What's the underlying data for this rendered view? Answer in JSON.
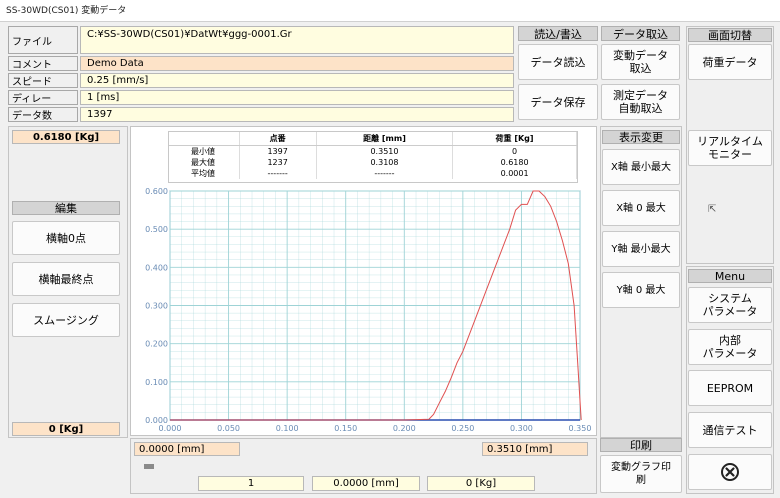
{
  "window": {
    "title": "SS-30WD(CS01) 変動データ"
  },
  "info": {
    "file_label": "ファイル",
    "file_value": "C:¥SS-30WD(CS01)¥DatWt¥ggg-0001.Gr",
    "comment_label": "コメント",
    "comment_value": "Demo Data",
    "speed_label": "スピード",
    "speed_value": "0.25 [mm/s]",
    "delay_label": "ディレー",
    "delay_value": "1 [ms]",
    "count_label": "データ数",
    "count_value": "1397"
  },
  "io": {
    "readwrite_header": "読込/書込",
    "load_button": "データ読込",
    "save_button": "データ保存",
    "fetch_header": "データ取込",
    "fetch_var_button": "変動データ\n取込",
    "fetch_auto_button": "測定データ\n自動取込"
  },
  "left": {
    "max_load": "0.6180 [Kg]",
    "edit_header": "編集",
    "zero_button": "横軸0点",
    "end_button": "横軸最終点",
    "smoothing_button": "スムージング",
    "min_load": "0 [Kg]"
  },
  "stats": {
    "headers": [
      "",
      "点番",
      "距離 [mm]",
      "荷重 [Kg]"
    ],
    "rows": [
      [
        "最小値",
        "1397",
        "0.3510",
        "0"
      ],
      [
        "最大値",
        "1237",
        "0.3108",
        "0.6180"
      ],
      [
        "平均値",
        "-------",
        "-------",
        "0.0001"
      ]
    ]
  },
  "xrange": {
    "min": "0.0000 [mm]",
    "max": "0.3510 [mm]"
  },
  "cursor": {
    "index": "1",
    "distance": "0.0000 [mm]",
    "load": "0 [Kg]"
  },
  "display": {
    "header": "表示変更",
    "x_minmax": "X軸 最小最大",
    "x_zero": "X軸 0 最大",
    "y_minmax": "Y軸 最小最大",
    "y_zero": "Y軸 0 最大"
  },
  "print": {
    "header": "印刷",
    "graph_print": "変動グラフ印\n刷"
  },
  "screen": {
    "header": "画面切替",
    "load_data": "荷重データ",
    "realtime": "リアルタイム\nモニター"
  },
  "menu": {
    "header": "Menu",
    "system_params": "システム\nパラメータ",
    "internal_params": "内部\nパラメータ",
    "eeprom": "EEPROM",
    "comm_test": "通信テスト",
    "close_icon": "close-circle-icon"
  },
  "colors": {
    "curve": "#e05050",
    "grid": "#9ed3d6",
    "plot_bg": "#ffffff"
  },
  "chart_data": {
    "type": "line",
    "title": "",
    "xlabel": "",
    "ylabel": "",
    "xlim": [
      0,
      0.35
    ],
    "ylim": [
      0,
      0.6
    ],
    "xticks": [
      "0.000",
      "0.050",
      "0.100",
      "0.150",
      "0.200",
      "0.250",
      "0.300",
      "0.350"
    ],
    "yticks": [
      "0.000",
      "0.100",
      "0.200",
      "0.300",
      "0.400",
      "0.500",
      "0.600"
    ],
    "grid": true,
    "series": [
      {
        "x": [
          0,
          0.2,
          0.221,
          0.225,
          0.23,
          0.235,
          0.24,
          0.245,
          0.25,
          0.26,
          0.27,
          0.28,
          0.29,
          0.295,
          0.3,
          0.305,
          0.31,
          0.315,
          0.32,
          0.325,
          0.33,
          0.335,
          0.34,
          0.345,
          0.348,
          0.35,
          0.351
        ],
        "y": [
          0,
          0,
          0.002,
          0.015,
          0.045,
          0.075,
          0.11,
          0.15,
          0.18,
          0.26,
          0.34,
          0.42,
          0.5,
          0.55,
          0.565,
          0.565,
          0.6,
          0.6,
          0.585,
          0.56,
          0.52,
          0.47,
          0.41,
          0.3,
          0.15,
          0.05,
          0
        ]
      }
    ]
  }
}
